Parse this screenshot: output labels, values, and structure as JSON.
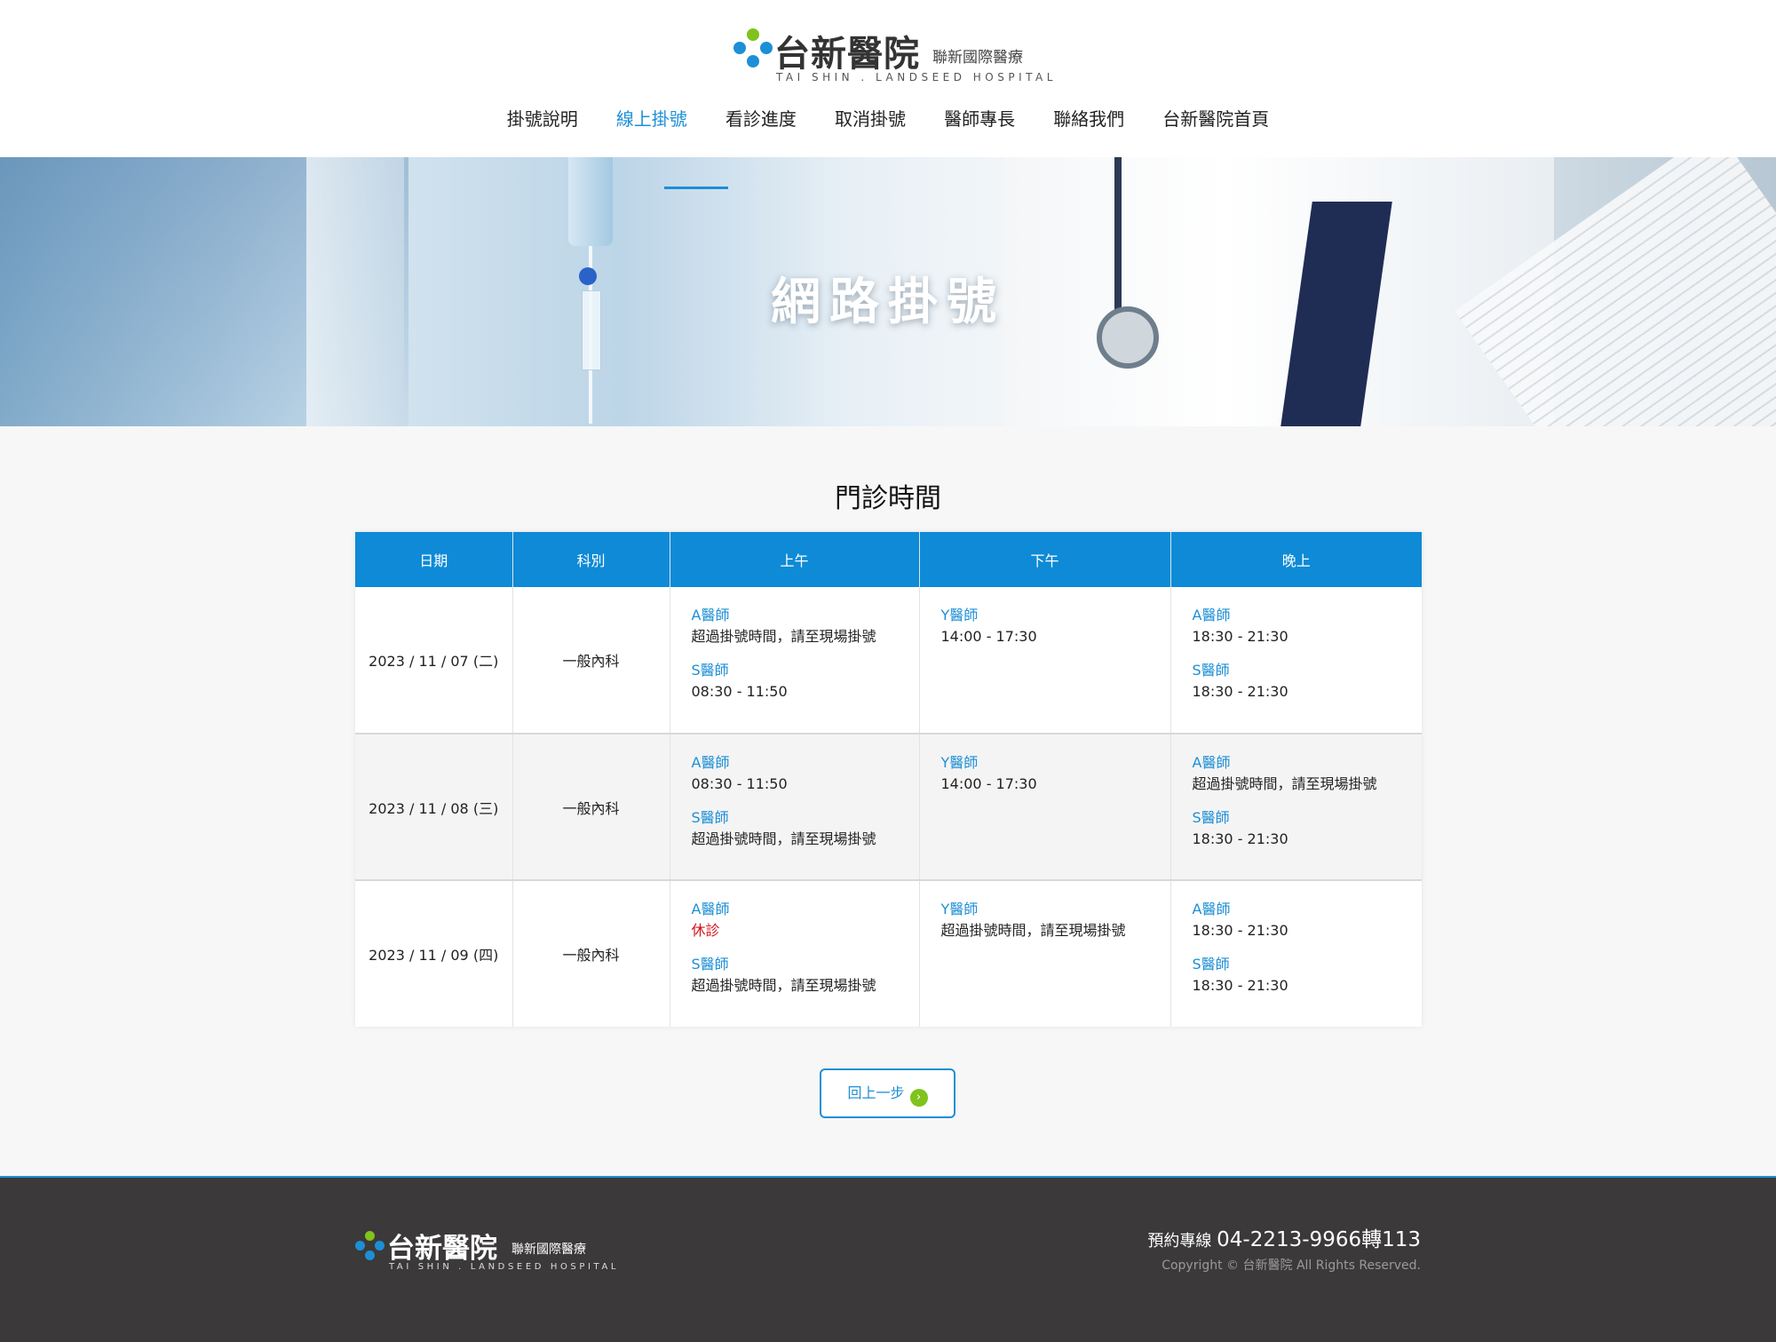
{
  "brand": {
    "name": "台新醫院",
    "sub": "聯新國際醫療",
    "english": "TAI SHIN . LANDSEED HOSPITAL",
    "colors": {
      "primary": "#1d8fd6",
      "green": "#7fc31c",
      "dot_blue": "#1d8fd6",
      "dot_green": "#7fc31c",
      "footer_bg": "#3b3939",
      "closed_red": "#d0131b"
    }
  },
  "nav": [
    {
      "label": "掛號說明",
      "active": false
    },
    {
      "label": "線上掛號",
      "active": true
    },
    {
      "label": "看診進度",
      "active": false
    },
    {
      "label": "取消掛號",
      "active": false
    },
    {
      "label": "醫師專長",
      "active": false
    },
    {
      "label": "聯絡我們",
      "active": false
    },
    {
      "label": "台新醫院首頁",
      "active": false
    }
  ],
  "banner": {
    "title": "網路掛號"
  },
  "section": {
    "title": "門診時間"
  },
  "table": {
    "headers": [
      "日期",
      "科別",
      "上午",
      "下午",
      "晚上"
    ],
    "rows": [
      {
        "date": "2023 / 11 / 07 (二)",
        "dept": "一般內科",
        "morning": [
          {
            "doctor": "A醫師",
            "time": "超過掛號時間，請至現場掛號"
          },
          {
            "doctor": "S醫師",
            "time": "08:30 - 11:50"
          }
        ],
        "afternoon": [
          {
            "doctor": "Y醫師",
            "time": "14:00 - 17:30"
          }
        ],
        "evening": [
          {
            "doctor": "A醫師",
            "time": "18:30 - 21:30"
          },
          {
            "doctor": "S醫師",
            "time": "18:30 - 21:30"
          }
        ]
      },
      {
        "date": "2023 / 11 / 08 (三)",
        "dept": "一般內科",
        "morning": [
          {
            "doctor": "A醫師",
            "time": "08:30 - 11:50"
          },
          {
            "doctor": "S醫師",
            "time": "超過掛號時間，請至現場掛號"
          }
        ],
        "afternoon": [
          {
            "doctor": "Y醫師",
            "time": "14:00 - 17:30"
          }
        ],
        "evening": [
          {
            "doctor": "A醫師",
            "time": "超過掛號時間，請至現場掛號"
          },
          {
            "doctor": "S醫師",
            "time": "18:30 - 21:30"
          }
        ]
      },
      {
        "date": "2023 / 11 / 09 (四)",
        "dept": "一般內科",
        "morning": [
          {
            "doctor": "A醫師",
            "time": "休診",
            "closed": true
          },
          {
            "doctor": "S醫師",
            "time": "超過掛號時間，請至現場掛號"
          }
        ],
        "afternoon": [
          {
            "doctor": "Y醫師",
            "time": "超過掛號時間，請至現場掛號"
          }
        ],
        "evening": [
          {
            "doctor": "A醫師",
            "time": "18:30 - 21:30"
          },
          {
            "doctor": "S醫師",
            "time": "18:30 - 21:30"
          }
        ]
      }
    ]
  },
  "back_button": {
    "label": "回上一步",
    "icon": "chevron-right-icon"
  },
  "footer": {
    "hotline_label": "預約專線",
    "hotline_number": "04-2213-9966轉113",
    "copyright": "Copyright © 台新醫院 All Rights Reserved."
  }
}
